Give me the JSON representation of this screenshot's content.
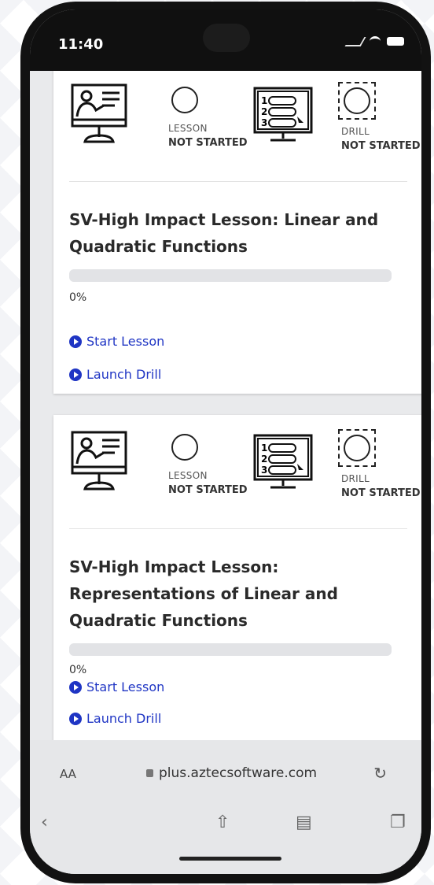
{
  "status_bar": {
    "time": "11:40"
  },
  "cards": [
    {
      "lesson_status_label": "LESSON",
      "lesson_status_value": "NOT STARTED",
      "drill_status_label": "DRILL",
      "drill_status_value": "NOT STARTED",
      "title": "SV-High Impact Lesson: Linear and Quadratic Functions",
      "progress_percent_text": "0%",
      "progress_fraction": 0,
      "start_lesson": "Start Lesson",
      "launch_drill": "Launch Drill"
    },
    {
      "lesson_status_label": "LESSON",
      "lesson_status_value": "NOT STARTED",
      "drill_status_label": "DRILL",
      "drill_status_value": "NOT STARTED",
      "title": "SV-High Impact Lesson: Representations of Linear and Quadratic Functions",
      "progress_percent_text": "0%",
      "progress_fraction": 0,
      "start_lesson": "Start Lesson",
      "launch_drill": "Launch Drill"
    }
  ],
  "browser": {
    "aa_label": "AA",
    "url": "plus.aztecsoftware.com"
  },
  "colors": {
    "link": "#1f35c4",
    "track": "#e2e3e6"
  },
  "icons": {
    "lesson": "teacher-presentation-icon",
    "drill": "numbered-list-screen-icon",
    "status": "empty-circle-icon",
    "action": "play-circle-icon"
  }
}
